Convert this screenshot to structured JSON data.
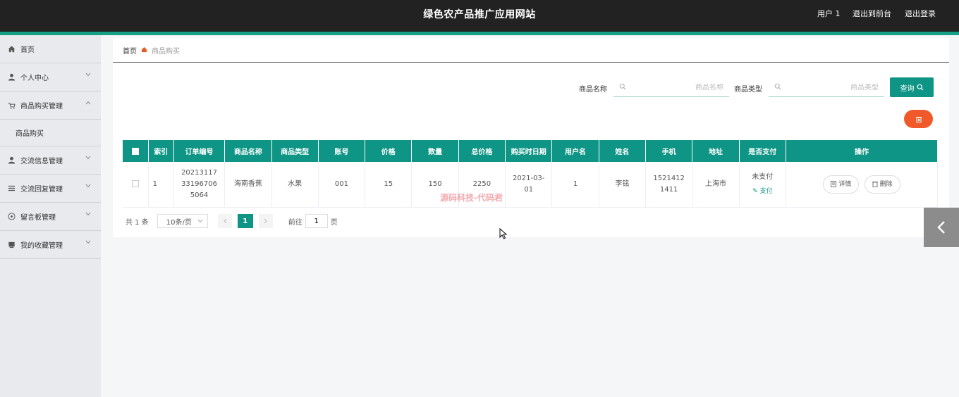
{
  "header": {
    "title": "绿色农产品推广应用网站",
    "user": "用户 1",
    "back_to_front": "退出到前台",
    "logout": "退出登录",
    "accent_color": "#16a085"
  },
  "sidebar": {
    "items": [
      {
        "label": "首页",
        "icon": "home-icon"
      },
      {
        "label": "个人中心",
        "icon": "user-icon"
      },
      {
        "label": "商品购买管理",
        "icon": "cart-icon"
      },
      {
        "label": "交流信息管理",
        "icon": "user-icon"
      },
      {
        "label": "交流回复管理",
        "icon": "list-icon"
      },
      {
        "label": "留言板管理",
        "icon": "message-icon"
      },
      {
        "label": "我的收藏管理",
        "icon": "bookmark-icon"
      }
    ],
    "sub_item": "商品购买"
  },
  "breadcrumb": {
    "home": "首页",
    "current": "商品购买"
  },
  "search": {
    "name_label": "商品名称",
    "name_placeholder": "商品名称",
    "type_label": "商品类型",
    "type_placeholder": "商品类型",
    "query_button": "查询"
  },
  "table": {
    "columns": [
      "索引",
      "订单编号",
      "商品名称",
      "商品类型",
      "账号",
      "价格",
      "数量",
      "总价格",
      "购买时日期",
      "用户名",
      "姓名",
      "手机",
      "地址",
      "是否支付",
      "操作"
    ],
    "rows": [
      {
        "index": "1",
        "order_no": "20213117331967065064",
        "product_name": "海南香蕉",
        "product_type": "水果",
        "account": "001",
        "price": "15",
        "quantity": "150",
        "total": "2250",
        "date": "2021-03-01",
        "username": "1",
        "name": "李铭",
        "phone": "15214121411",
        "address": "上海市",
        "pay_status": "未支付",
        "pay_link": "支付",
        "detail": "详情",
        "delete": "删除"
      }
    ]
  },
  "pagination": {
    "total": "共 1 条",
    "page_size": "10条/页",
    "current_page": "1",
    "goto_label": "前往",
    "goto_value": "1",
    "page_suffix": "页"
  },
  "watermark": "源码科技-代码君"
}
